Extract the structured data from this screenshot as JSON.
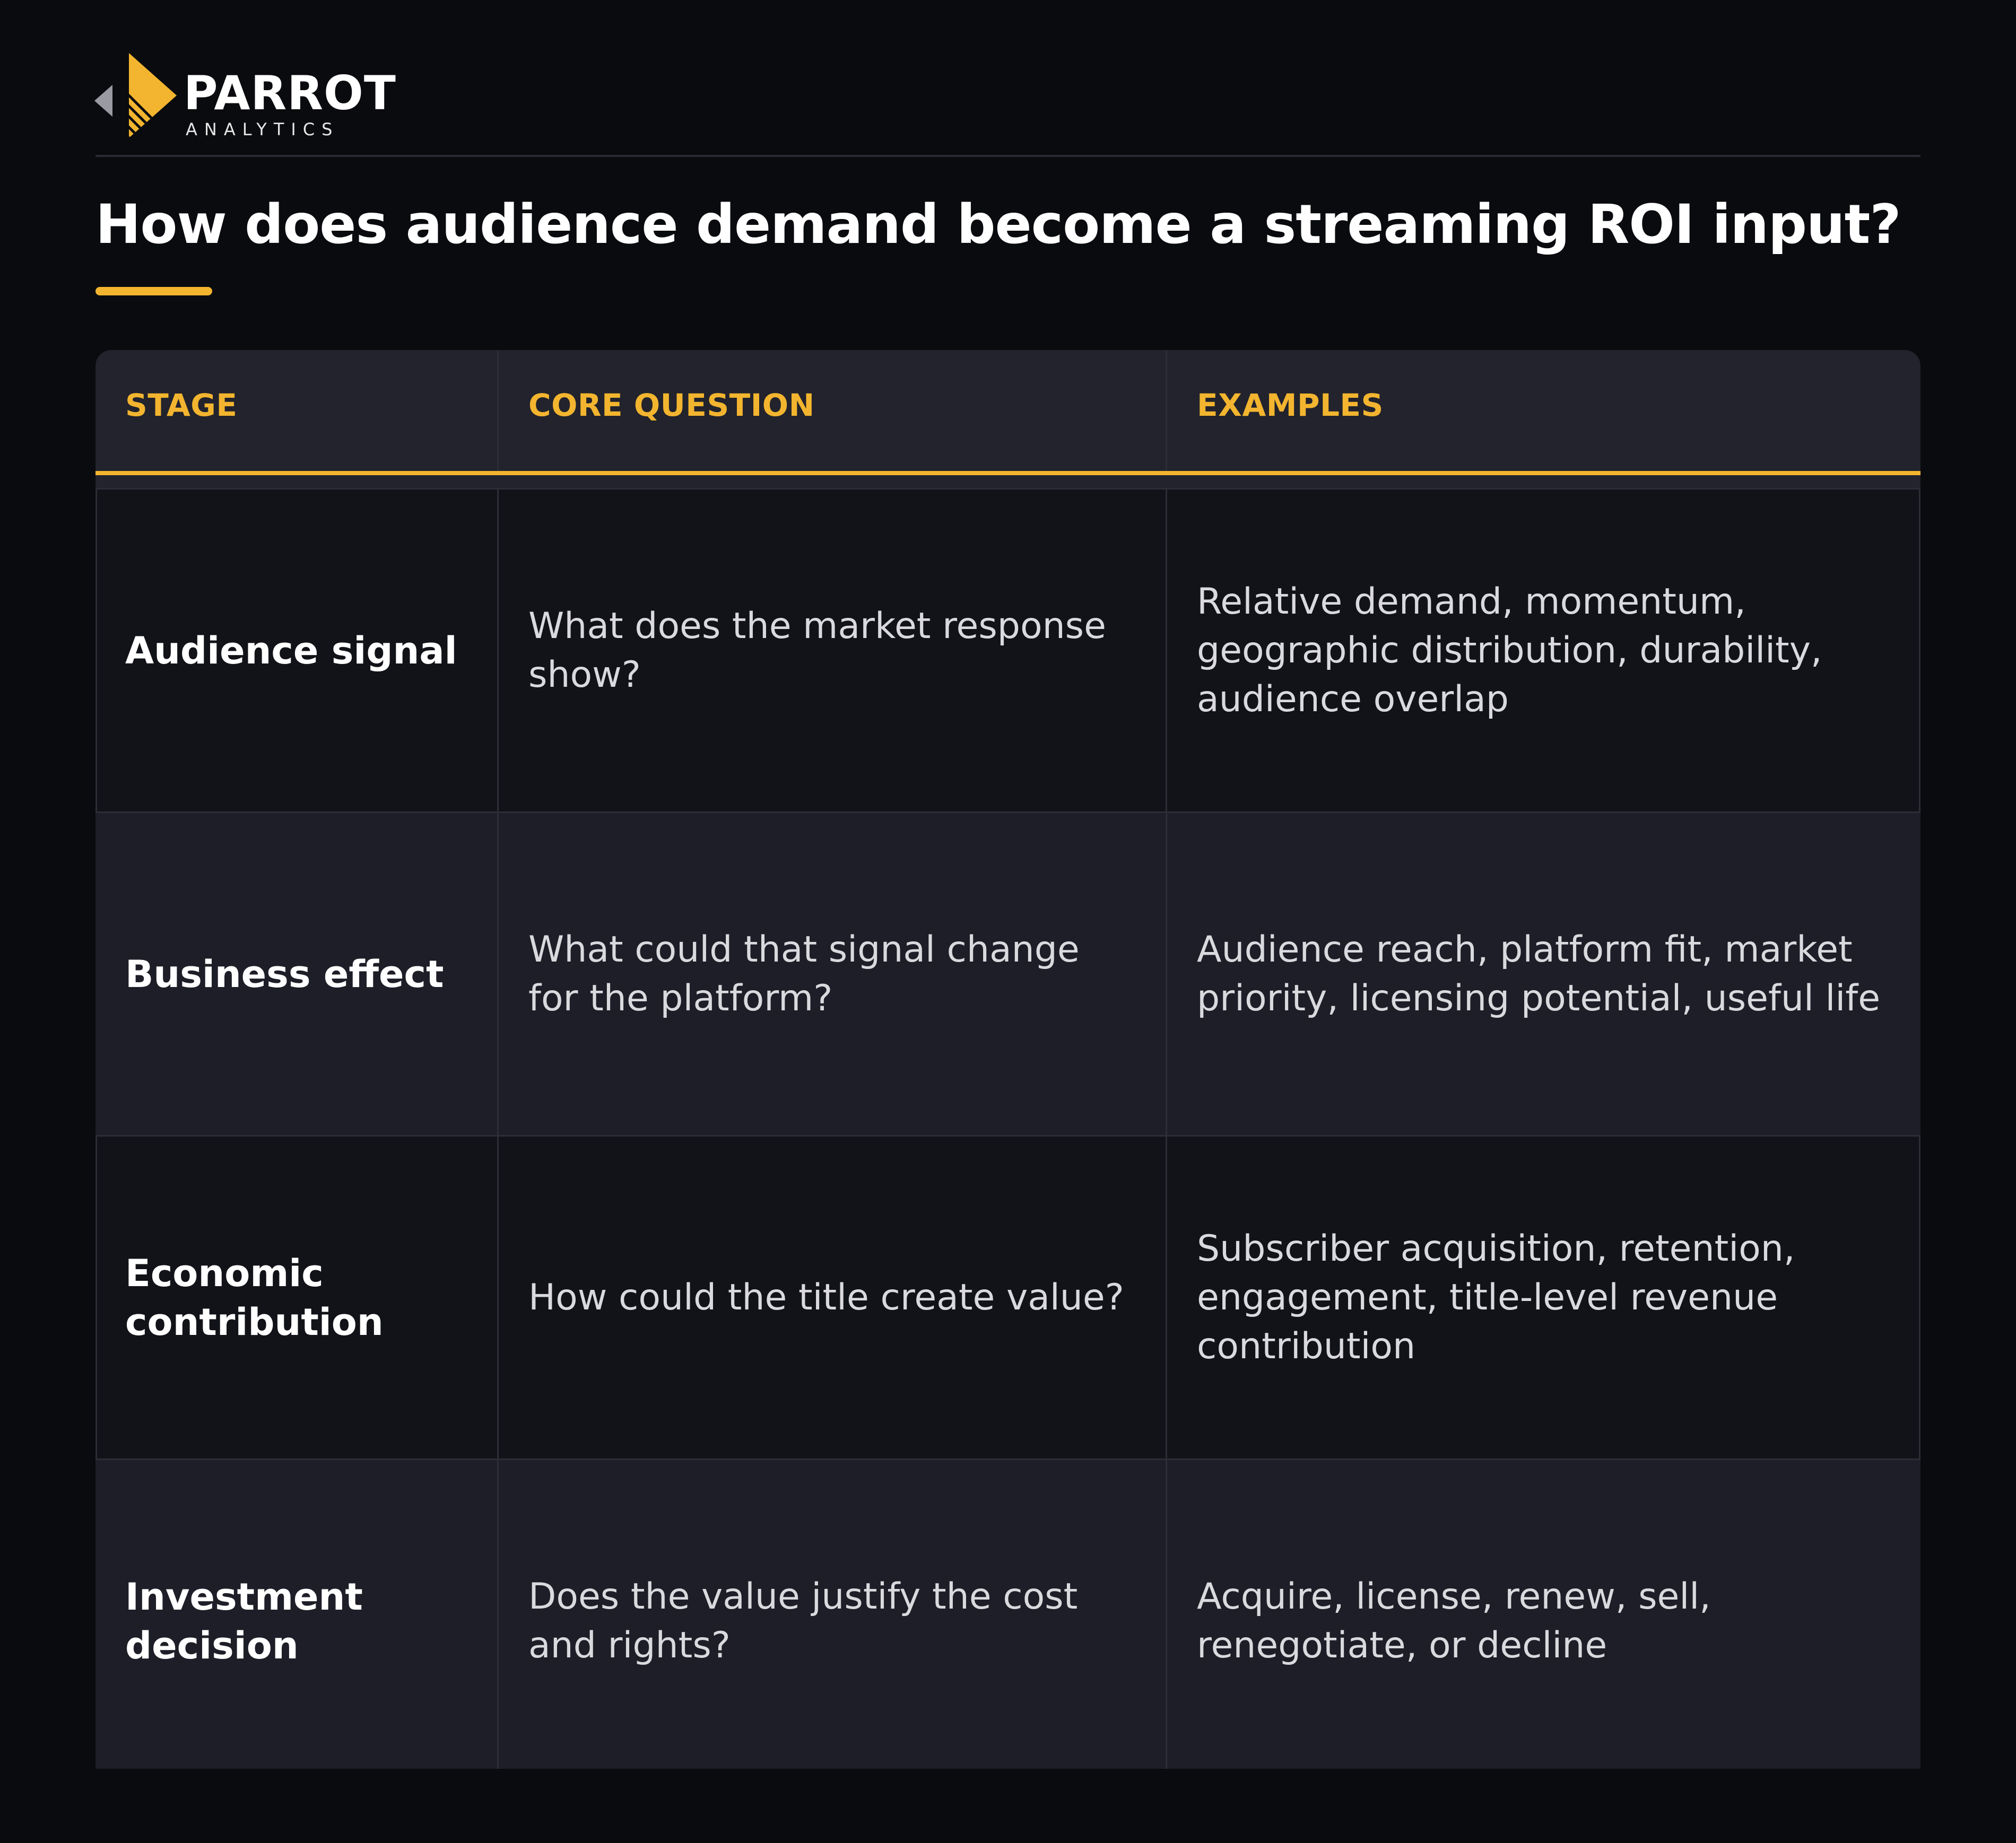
{
  "logo": {
    "name": "PARROT",
    "sub": "ANALYTICS",
    "accent": "#f3b52f"
  },
  "title": "How does audience demand become a streaming ROI input?",
  "colors": {
    "background": "#0a0b0e",
    "accent": "#f3b52f",
    "row_dark": "#121318",
    "row_light": "#1d1e27"
  },
  "table": {
    "headers": [
      "STAGE",
      "CORE QUESTION",
      "EXAMPLES"
    ],
    "rows": [
      {
        "stage": "Audience signal",
        "question": "What does the market response show?",
        "examples": "Relative demand, momentum, geographic distribution, durability, audience overlap"
      },
      {
        "stage": "Business effect",
        "question": "What could that signal change for the platform?",
        "examples": "Audience reach, platform fit, market priority, licensing potential, useful life"
      },
      {
        "stage": "Economic contribution",
        "question": "How could the title create value?",
        "examples": "Subscriber acquisition, retention, engagement, title-level revenue contribution"
      },
      {
        "stage": "Investment decision",
        "question": "Does the value justify the cost and rights?",
        "examples": "Acquire, license, renew, sell, renegotiate, or decline"
      }
    ]
  }
}
